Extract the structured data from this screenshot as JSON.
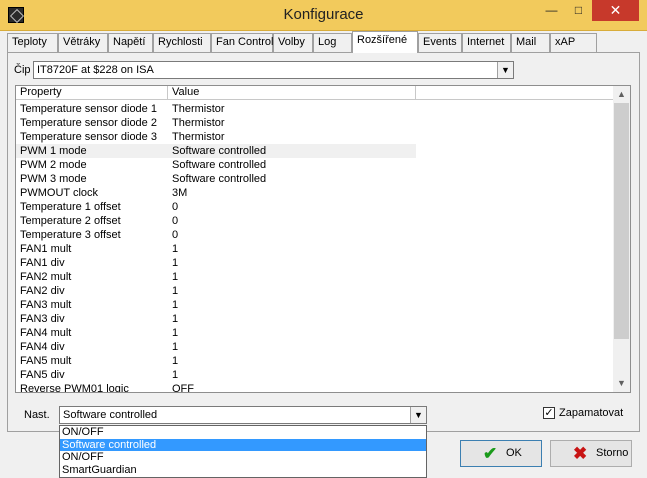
{
  "window": {
    "title": "Konfigurace",
    "minimize_glyph": "—",
    "maximize_glyph": "□",
    "close_glyph": "✕"
  },
  "tabs": [
    {
      "label": "Teploty"
    },
    {
      "label": "Větráky"
    },
    {
      "label": "Napětí"
    },
    {
      "label": "Rychlosti"
    },
    {
      "label": "Fan Control"
    },
    {
      "label": "Volby"
    },
    {
      "label": "Log"
    },
    {
      "label": "Rozšířené"
    },
    {
      "label": "Events"
    },
    {
      "label": "Internet"
    },
    {
      "label": "Mail"
    },
    {
      "label": "xAP"
    }
  ],
  "active_tab": "Rozšířené",
  "chip": {
    "label": "Čip",
    "value": "IT8720F at $228 on ISA"
  },
  "grid": {
    "headers": {
      "property": "Property",
      "value": "Value"
    },
    "selected_row": 3,
    "rows": [
      {
        "property": "Temperature sensor diode 1",
        "value": "Thermistor"
      },
      {
        "property": "Temperature sensor diode 2",
        "value": "Thermistor"
      },
      {
        "property": "Temperature sensor diode 3",
        "value": "Thermistor"
      },
      {
        "property": "PWM 1 mode",
        "value": "Software controlled"
      },
      {
        "property": "PWM 2 mode",
        "value": "Software controlled"
      },
      {
        "property": "PWM 3 mode",
        "value": "Software controlled"
      },
      {
        "property": "PWMOUT clock",
        "value": "3M"
      },
      {
        "property": "Temperature 1 offset",
        "value": "0"
      },
      {
        "property": "Temperature 2 offset",
        "value": "0"
      },
      {
        "property": "Temperature 3 offset",
        "value": "0"
      },
      {
        "property": "FAN1 mult",
        "value": "1"
      },
      {
        "property": "FAN1 div",
        "value": "1"
      },
      {
        "property": "FAN2 mult",
        "value": "1"
      },
      {
        "property": "FAN2 div",
        "value": "1"
      },
      {
        "property": "FAN3 mult",
        "value": "1"
      },
      {
        "property": "FAN3 div",
        "value": "1"
      },
      {
        "property": "FAN4 mult",
        "value": "1"
      },
      {
        "property": "FAN4 div",
        "value": "1"
      },
      {
        "property": "FAN5 mult",
        "value": "1"
      },
      {
        "property": "FAN5 div",
        "value": "1"
      },
      {
        "property": "Reverse PWM01 logic",
        "value": "OFF"
      }
    ]
  },
  "nast": {
    "label": "Nast.",
    "value": "Software controlled",
    "options": [
      "ON/OFF",
      "Software controlled",
      "ON/OFF",
      "SmartGuardian"
    ],
    "highlighted": 1
  },
  "remember": {
    "label": "Zapamatovat",
    "checked": true,
    "check_glyph": "✓"
  },
  "buttons": {
    "ok": "OK",
    "storno": "Storno",
    "ok_icon": "✔",
    "storno_icon": "✖"
  },
  "icons": {
    "dropdown_arrow": "▼",
    "scroll_up": "▲",
    "scroll_down": "▼"
  }
}
